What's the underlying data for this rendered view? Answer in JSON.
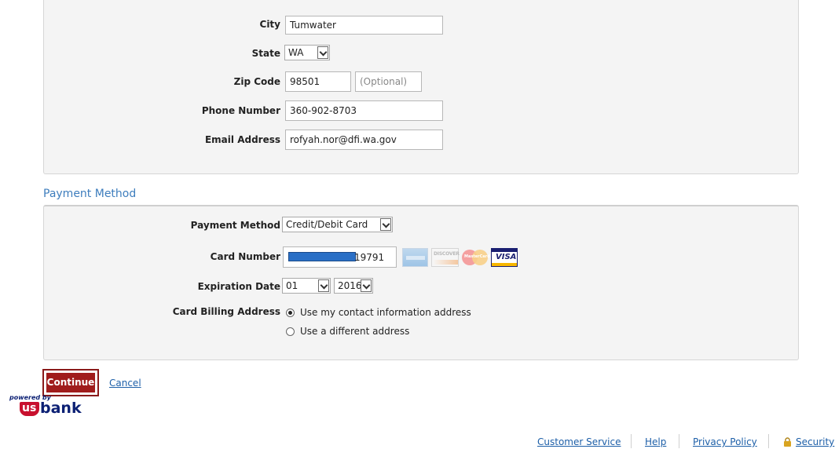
{
  "contact": {
    "city_label": "City",
    "city_value": "Tumwater",
    "state_label": "State",
    "state_value": "WA",
    "zip_label": "Zip Code",
    "zip_value": "98501",
    "zip_ext_placeholder": "(Optional)",
    "phone_label": "Phone Number",
    "phone_value": "360-902-8703",
    "email_label": "Email Address",
    "email_value": "rofyah.nor@dfi.wa.gov"
  },
  "payment": {
    "section_title": "Payment Method",
    "method_label": "Payment Method",
    "method_value": "Credit/Debit Card",
    "card_number_label": "Card Number",
    "card_number_visible": "19791",
    "card_logos": [
      "american-express",
      "discover",
      "mastercard",
      "visa"
    ],
    "discover_text": "DISCOVER",
    "mastercard_text": "MasterCard",
    "visa_text": "VISA",
    "expiration_label": "Expiration Date",
    "exp_month": "01",
    "exp_year": "2016",
    "billing_label": "Card Billing Address",
    "billing_option_1": "Use my contact information address",
    "billing_option_2": "Use a different address",
    "billing_selected": 1
  },
  "actions": {
    "continue_label": "Continue",
    "cancel_label": "Cancel"
  },
  "branding": {
    "powered_by": "powered by",
    "logo_us": "us",
    "logo_bank": "bank",
    "logo_color": "#c8102e",
    "logo_text_color": "#0c2074"
  },
  "footer": {
    "customer_service": "Customer Service",
    "help": "Help",
    "privacy_policy": "Privacy Policy",
    "security": "Security"
  },
  "colors": {
    "link": "#1d5fa8",
    "section_title": "#3d7dbd",
    "continue_bg": "#a01c1c",
    "panel_bg": "#f4f4f4"
  }
}
